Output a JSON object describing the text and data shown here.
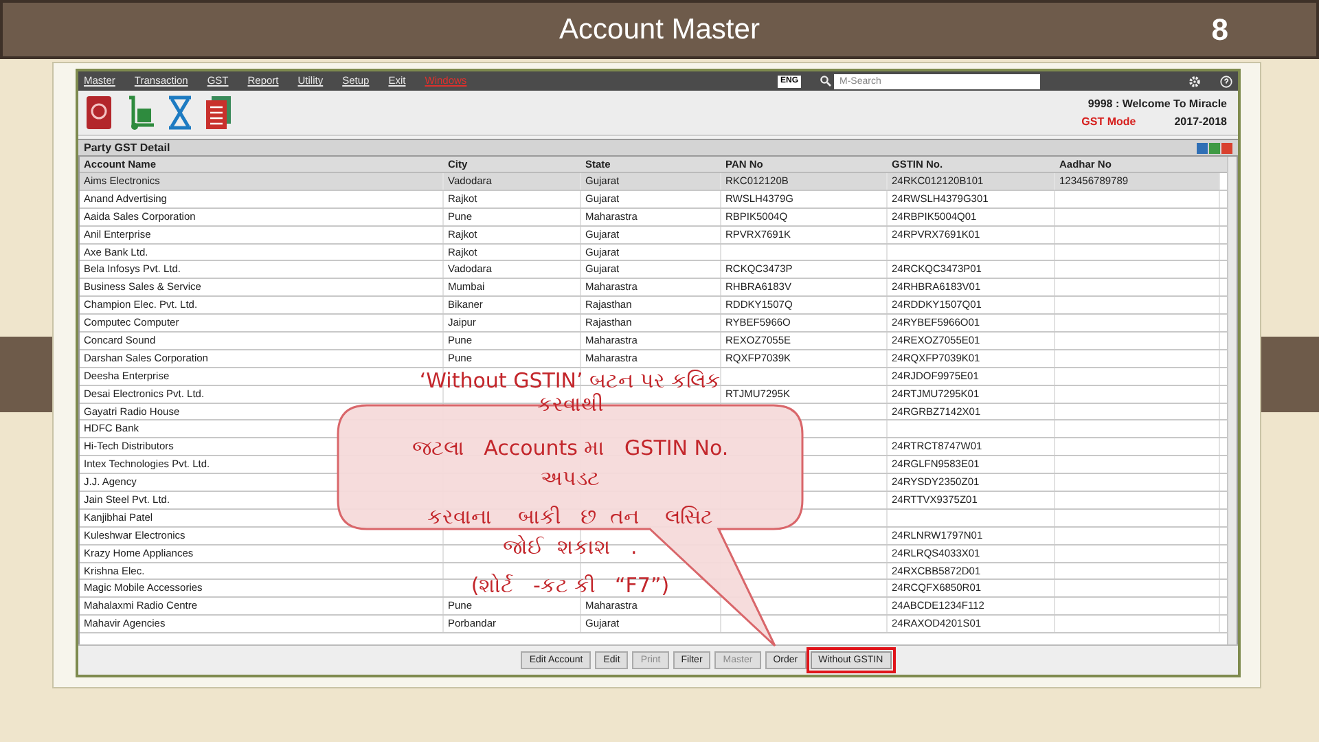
{
  "slide": {
    "title": "Account Master",
    "page_number": "8"
  },
  "app": {
    "menu": [
      {
        "label": "Master",
        "kind": "normal"
      },
      {
        "label": "Transaction",
        "kind": "normal"
      },
      {
        "label": "GST",
        "kind": "normal"
      },
      {
        "label": "Report",
        "kind": "normal"
      },
      {
        "label": "Utility",
        "kind": "normal"
      },
      {
        "label": "Setup",
        "kind": "normal"
      },
      {
        "label": "Exit",
        "kind": "normal"
      },
      {
        "label": "Windows",
        "kind": "alert"
      }
    ],
    "language": "ENG",
    "search": {
      "placeholder": "M-Search"
    },
    "welcome": "9998 : Welcome To Miracle",
    "mode": "GST Mode",
    "year": "2017-2018",
    "panel_title": "Party GST Detail",
    "table": {
      "columns": [
        "Account Name",
        "City",
        "State",
        "PAN No",
        "GSTIN No.",
        "Aadhar No"
      ],
      "rows": [
        {
          "selected": true,
          "cells": [
            "Aims Electronics",
            "Vadodara",
            "Gujarat",
            "RKC012120B",
            "24RKC012120B101",
            "123456789789"
          ]
        },
        {
          "selected": false,
          "cells": [
            "Anand Advertising",
            "Rajkot",
            "Gujarat",
            "RWSLH4379G",
            "24RWSLH4379G301",
            null
          ]
        },
        {
          "selected": false,
          "cells": [
            "Aaida Sales Corporation",
            "Pune",
            "Maharastra",
            "RBPIK5004Q",
            "24RBPIK5004Q01",
            null
          ]
        },
        {
          "selected": false,
          "cells": [
            "Anil Enterprise",
            "Rajkot",
            "Gujarat",
            "RPVRX7691K",
            "24RPVRX7691K01",
            null
          ]
        },
        {
          "selected": false,
          "cells": [
            "Axe Bank Ltd.",
            "Rajkot",
            "Gujarat",
            null,
            null,
            null
          ]
        },
        {
          "selected": false,
          "cells": [
            "Bela Infosys Pvt. Ltd.",
            "Vadodara",
            "Gujarat",
            "RCKQC3473P",
            "24RCKQC3473P01",
            null
          ]
        },
        {
          "selected": false,
          "cells": [
            "Business Sales & Service",
            "Mumbai",
            "Maharastra",
            "RHBRA6183V",
            "24RHBRA6183V01",
            null
          ]
        },
        {
          "selected": false,
          "cells": [
            "Champion Elec. Pvt. Ltd.",
            "Bikaner",
            "Rajasthan",
            "RDDKY1507Q",
            "24RDDKY1507Q01",
            null
          ]
        },
        {
          "selected": false,
          "cells": [
            "Computec Computer",
            "Jaipur",
            "Rajasthan",
            "RYBEF5966O",
            "24RYBEF5966O01",
            null
          ]
        },
        {
          "selected": false,
          "cells": [
            "Concard Sound",
            "Pune",
            "Maharastra",
            "REXOZ7055E",
            "24REXOZ7055E01",
            null
          ]
        },
        {
          "selected": false,
          "cells": [
            "Darshan Sales Corporation",
            "Pune",
            "Maharastra",
            "RQXFP7039K",
            "24RQXFP7039K01",
            null
          ]
        },
        {
          "selected": false,
          "cells": [
            "Deesha Enterprise",
            null,
            null,
            null,
            "24RJDOF9975E01",
            null
          ]
        },
        {
          "selected": false,
          "cells": [
            "Desai Electronics Pvt. Ltd.",
            null,
            null,
            "RTJMU7295K",
            "24RTJMU7295K01",
            null
          ]
        },
        {
          "selected": false,
          "cells": [
            "Gayatri Radio House",
            null,
            null,
            null,
            "24RGRBZ7142X01",
            null
          ]
        },
        {
          "selected": false,
          "cells": [
            "HDFC Bank",
            null,
            null,
            null,
            null,
            null
          ]
        },
        {
          "selected": false,
          "cells": [
            "Hi-Tech Distributors",
            null,
            null,
            null,
            "24RTRCT8747W01",
            null
          ]
        },
        {
          "selected": false,
          "cells": [
            "Intex Technologies Pvt. Ltd.",
            null,
            null,
            null,
            "24RGLFN9583E01",
            null
          ]
        },
        {
          "selected": false,
          "cells": [
            "J.J. Agency",
            null,
            null,
            null,
            "24RYSDY2350Z01",
            null
          ]
        },
        {
          "selected": false,
          "cells": [
            "Jain Steel Pvt. Ltd.",
            null,
            null,
            null,
            "24RTTVX9375Z01",
            null
          ]
        },
        {
          "selected": false,
          "cells": [
            "Kanjibhai Patel",
            null,
            null,
            null,
            null,
            null
          ]
        },
        {
          "selected": false,
          "cells": [
            "Kuleshwar Electronics",
            null,
            null,
            null,
            "24RLNRW1797N01",
            null
          ]
        },
        {
          "selected": false,
          "cells": [
            "Krazy Home Appliances",
            null,
            null,
            null,
            "24RLRQS4033X01",
            null
          ]
        },
        {
          "selected": false,
          "cells": [
            "Krishna Elec.",
            null,
            null,
            null,
            "24RXCBB5872D01",
            null
          ]
        },
        {
          "selected": false,
          "cells": [
            "Magic Mobile Accessories",
            null,
            null,
            null,
            "24RCQFX6850R01",
            null
          ]
        },
        {
          "selected": false,
          "cells": [
            "Mahalaxmi Radio Centre",
            "Pune",
            "Maharastra",
            null,
            "24ABCDE1234F112",
            null
          ]
        },
        {
          "selected": false,
          "cells": [
            "Mahavir Agencies",
            "Porbandar",
            "Gujarat",
            null,
            "24RAXOD4201S01",
            null
          ]
        }
      ]
    },
    "buttons": [
      {
        "label": "Edit Account",
        "disabled": false,
        "highlighted": false
      },
      {
        "label": "Edit",
        "disabled": false,
        "highlighted": false
      },
      {
        "label": "Print",
        "disabled": true,
        "highlighted": false
      },
      {
        "label": "Filter",
        "disabled": false,
        "highlighted": false
      },
      {
        "label": "Master",
        "disabled": true,
        "highlighted": false
      },
      {
        "label": "Order",
        "disabled": false,
        "highlighted": false
      },
      {
        "label": "Without GSTIN",
        "disabled": false,
        "highlighted": true
      }
    ]
  },
  "callout": {
    "lines": [
      "‘Without GSTIN’ બટન પર કલિક",
      "કરવાથી",
      "જટલા   Accounts મા   GSTIN No.",
      "અપડટ",
      "કરવાના    બાકી   છ  તન    લસિટ",
      "જોઈ  શકાશ   .",
      "(શોર્ટ   -કટ કી   “F7”)"
    ]
  }
}
